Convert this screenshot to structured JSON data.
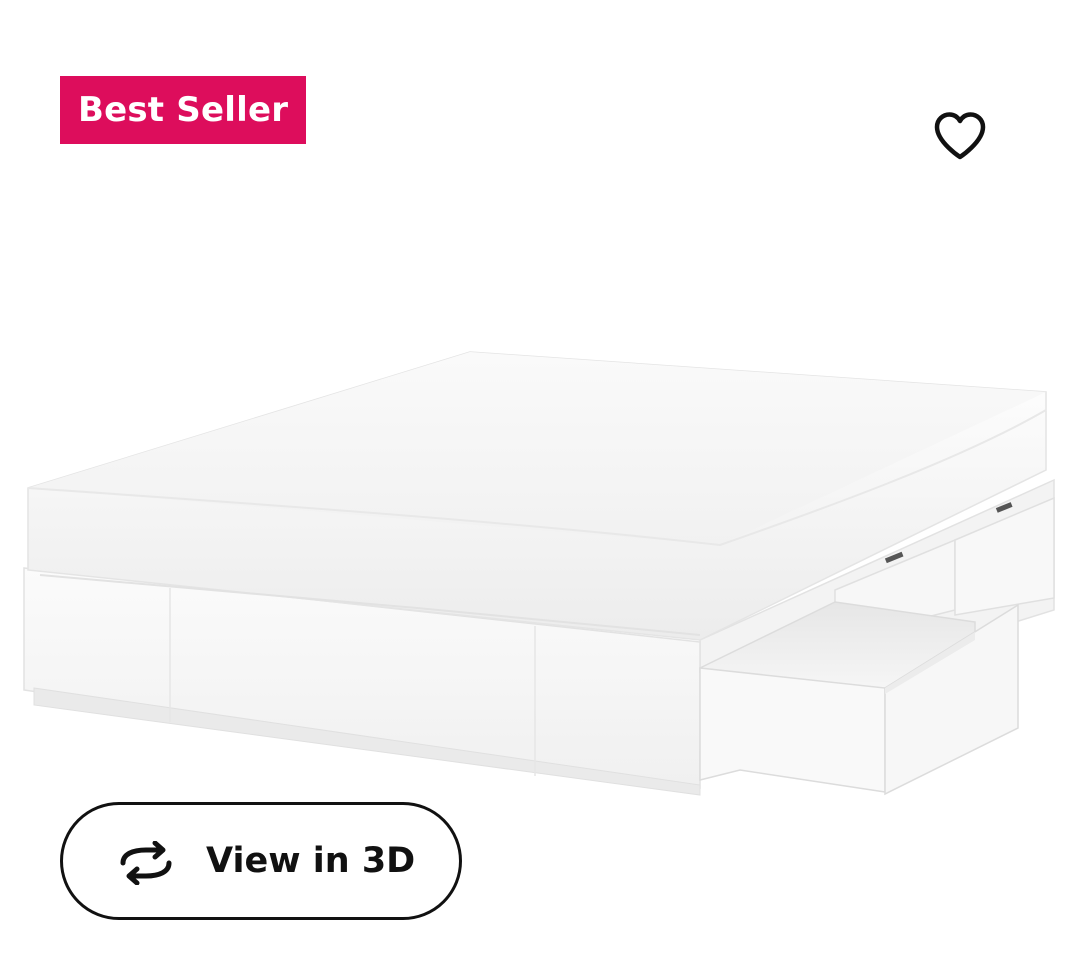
{
  "badge": {
    "label": "Best Seller",
    "background": "#dd0d5c",
    "text_color": "#ffffff"
  },
  "favorite": {
    "icon": "heart-outline-icon",
    "color": "#111111"
  },
  "product_image": {
    "description_icon": "bed-frame-with-storage-image"
  },
  "view_3d": {
    "label": "View in 3D",
    "icon": "rotate-3d-icon",
    "border_color": "#111111"
  }
}
